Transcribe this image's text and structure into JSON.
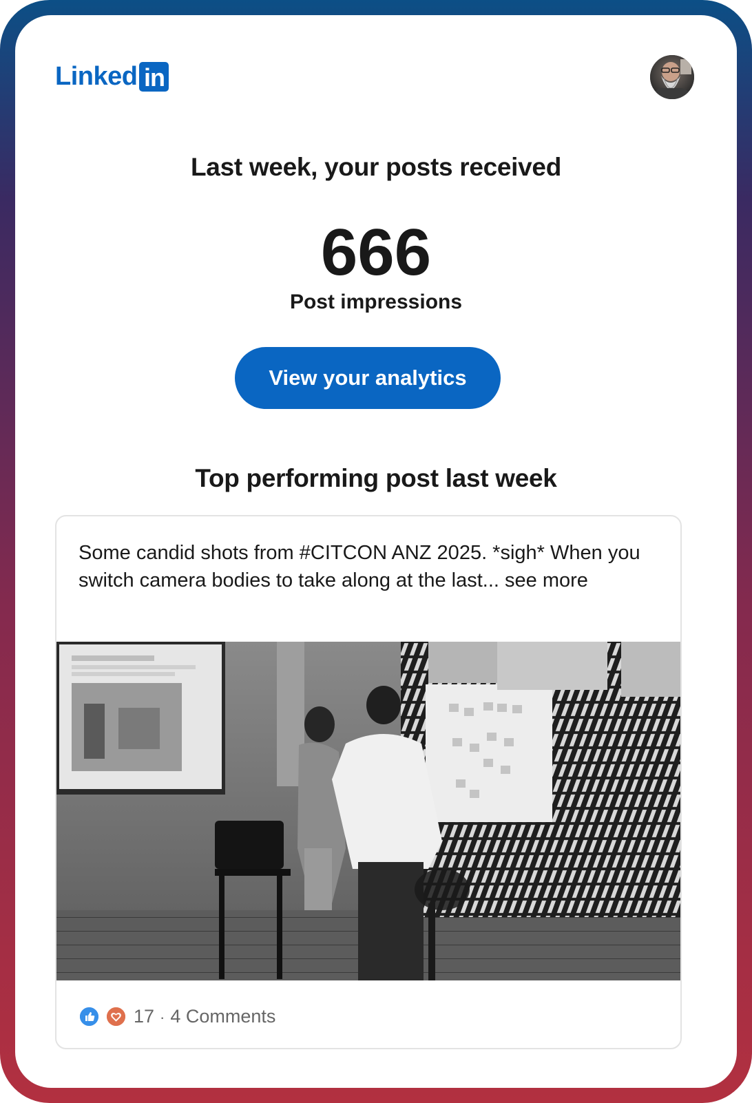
{
  "brand": {
    "wordmark": "Linked",
    "box_text": "in",
    "color": "#0a66c2"
  },
  "header": {
    "avatar_icon": "user-avatar"
  },
  "summary": {
    "headline": "Last week, your posts received",
    "impressions_value": "666",
    "impressions_label": "Post impressions",
    "cta_label": "View your analytics"
  },
  "top_post": {
    "section_title": "Top performing post last week",
    "text": "Some candid shots from #CITCON ANZ 2025. *sigh* When you switch camera bodies to take along at the last...",
    "see_more": "see more",
    "image_icon": "post-photo",
    "reactions_count": "17",
    "separator": "·",
    "comments_label": "4 Comments",
    "reaction_icons": [
      "like-reaction-icon",
      "love-reaction-icon"
    ]
  },
  "colors": {
    "accent": "#0a66c2",
    "text": "#191919",
    "muted": "#666666",
    "like": "#378fe9",
    "love": "#df704d"
  }
}
